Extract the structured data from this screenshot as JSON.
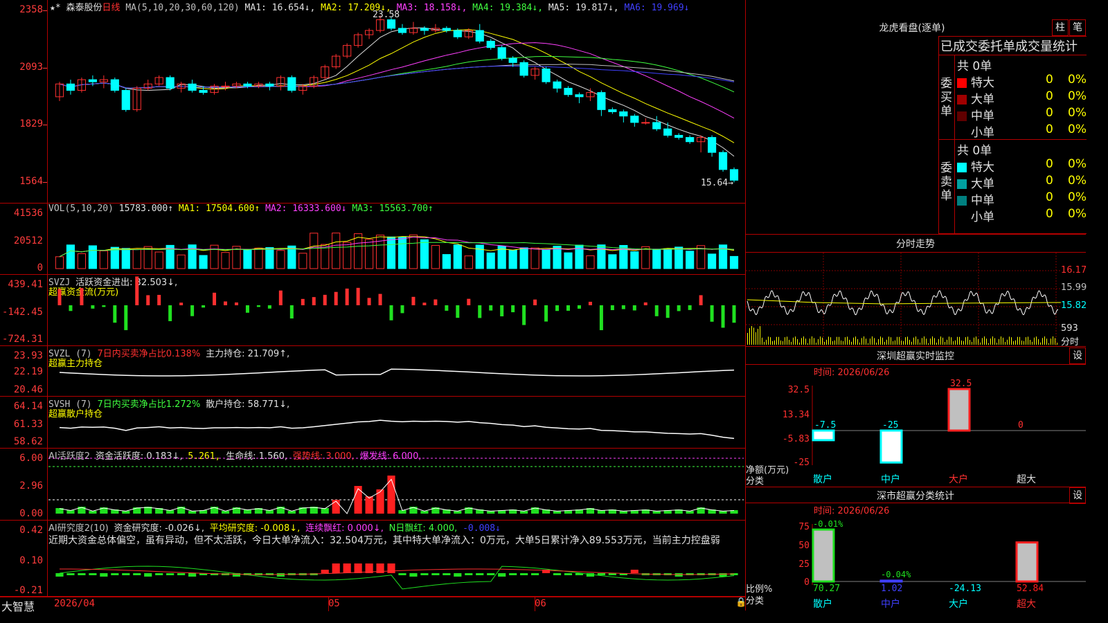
{
  "stock": {
    "name": "森泰股份",
    "period": "日线"
  },
  "ma_header": {
    "label": "MA(5,10,20,30,60,120)",
    "items": [
      {
        "text": "MA1: 16.654↓",
        "color": "#e0e0e0"
      },
      {
        "text": "MA2: 17.209↓",
        "color": "#ffff00"
      },
      {
        "text": "MA3: 18.158↓",
        "color": "#ff40ff"
      },
      {
        "text": "MA4: 19.384↓",
        "color": "#40ff40"
      },
      {
        "text": "MA5: 19.817↓",
        "color": "#e0e0e0"
      },
      {
        "text": "MA6: 19.969↓",
        "color": "#4040ff"
      }
    ]
  },
  "price_axis": [
    "2358",
    "2093",
    "1829",
    "1564"
  ],
  "price_high_label": "23.58",
  "price_low_label": "15.64",
  "vol_header": {
    "label": "VOL(5,10,20)",
    "value": "15783.000↑",
    "ma1": "MA1: 17504.600↑",
    "ma2": "MA2: 16333.600↓",
    "ma3": "MA3: 15563.700↑"
  },
  "vol_axis": [
    "41536",
    "20512",
    "0"
  ],
  "svzj": {
    "title": "SVZJ",
    "label": "活跃资金进出: 32.503↓,",
    "sub": "超赢资金流(万元)",
    "axis": [
      "439.41",
      "-142.45",
      "-724.31"
    ]
  },
  "svzl": {
    "title": "SVZL (7)",
    "ratio": "7日内买卖净占比0.138%",
    "hold": "主力持仓: 21.709↑,",
    "sub": "超赢主力持仓",
    "axis": [
      "23.93",
      "22.19",
      "20.46"
    ]
  },
  "svsh": {
    "title": "SVSH (7)",
    "ratio": "7日内买卖净占比1.272%",
    "hold": "散户持仓: 58.771↓,",
    "sub": "超赢散户持仓",
    "axis": [
      "64.14",
      "61.33",
      "58.62"
    ]
  },
  "ai_act": {
    "title": "AI活跃度2",
    "a": "资金活跃度: 0.183↓,",
    "b": "5.261,",
    "c": "生命线: 1.560,",
    "d": "强势线: 3.000,",
    "e": "爆发线: 6.000,",
    "axis": [
      "6.00",
      "2.96",
      "0.00"
    ]
  },
  "ai_res": {
    "title": "AI研究度2(10)",
    "a": "资金研究度: -0.026↓,",
    "b": "平均研究度: -0.008↓,",
    "c": "连续飘红: 0.000↓,",
    "d": "N日飘红: 4.000,",
    "e": "-0.008↓",
    "axis": [
      "0.42",
      "0.10",
      "-0.21"
    ],
    "comment": "近期大资金总体偏空，虽有异动，但不太活跃，今日大单净流入：32.504万元，其中特大单净流入：0万元，大单5日累计净入89.553万元，当前主力控盘弱"
  },
  "bottom": {
    "brand": "大智慧",
    "date": "2026/04",
    "m5": "05",
    "m6": "06"
  },
  "right": {
    "dragon_title": "龙虎看盘(逐单)",
    "tab_zhu": "柱",
    "tab_bi": "笔",
    "stats_title": "已成交委托单成交量统计",
    "buy": {
      "side": "委买单",
      "total": "共 0单",
      "rows": [
        {
          "name": "特大",
          "n": "0",
          "pct": "0%",
          "color": "#ff0000"
        },
        {
          "name": "大单",
          "n": "0",
          "pct": "0%",
          "color": "#a00000"
        },
        {
          "name": "中单",
          "n": "0",
          "pct": "0%",
          "color": "#600000"
        },
        {
          "name": "小单",
          "n": "0",
          "pct": "0%",
          "color": "#000000"
        }
      ]
    },
    "sell": {
      "side": "委卖单",
      "total": "共 0单",
      "rows": [
        {
          "name": "特大",
          "n": "0",
          "pct": "0%",
          "color": "#00ffff"
        },
        {
          "name": "大单",
          "n": "0",
          "pct": "0%",
          "color": "#00a0a0"
        },
        {
          "name": "中单",
          "n": "0",
          "pct": "0%",
          "color": "#008080"
        },
        {
          "name": "小单",
          "n": "0",
          "pct": "0%",
          "color": "#000000"
        }
      ]
    },
    "intraday_title": "分时走势",
    "intraday_axis": [
      "16.17",
      "15.99",
      "15.82"
    ],
    "intraday_vol": "593",
    "intraday_unit": "分时",
    "sz_monitor": {
      "title": "深圳超赢实时监控",
      "set": "设",
      "time": "时间: 2026/06/26",
      "axis": [
        "32.5",
        "13.34",
        "-5.83",
        "-25"
      ],
      "unit": "净额(万元)",
      "cat": "分类",
      "bars": [
        {
          "label": "散户",
          "value": -7.5,
          "vtext": "-7.5"
        },
        {
          "label": "中户",
          "value": -25,
          "vtext": "-25"
        },
        {
          "label": "大户",
          "value": 32.5,
          "vtext": "32.5"
        },
        {
          "label": "超大",
          "value": 0,
          "vtext": "0"
        }
      ]
    },
    "sz_class": {
      "title": "深市超赢分类统计",
      "set": "设",
      "time": "时间: 2026/06/26",
      "axis": [
        "75",
        "50",
        "25",
        "0"
      ],
      "unit": "比例%",
      "cat": "分类",
      "bars": [
        {
          "label": "散户",
          "value": 70.27,
          "vtext": "70.27",
          "top": "-0.01%"
        },
        {
          "label": "中户",
          "value": 1.02,
          "vtext": "1.02",
          "top": "-0.04%"
        },
        {
          "label": "大户",
          "value": -24.13,
          "vtext": "-24.13",
          "top": ""
        },
        {
          "label": "超大",
          "value": 52.84,
          "vtext": "52.84",
          "top": ""
        }
      ]
    }
  },
  "chart_data": {
    "type": "candlestick",
    "candles": [
      [
        19.8,
        20.4,
        20.5,
        19.6
      ],
      [
        20.4,
        20.1,
        20.6,
        19.9
      ],
      [
        20.1,
        20.6,
        20.7,
        20.0
      ],
      [
        20.6,
        20.5,
        20.8,
        20.3
      ],
      [
        20.5,
        20.6,
        20.8,
        20.2
      ],
      [
        20.6,
        20.1,
        20.7,
        20.0
      ],
      [
        20.1,
        19.2,
        20.2,
        19.1
      ],
      [
        19.2,
        20.2,
        20.3,
        19.1
      ],
      [
        20.2,
        20.4,
        20.6,
        20.1
      ],
      [
        20.4,
        20.7,
        20.8,
        20.3
      ],
      [
        20.7,
        20.2,
        20.8,
        20.1
      ],
      [
        20.2,
        20.4,
        20.5,
        20.0
      ],
      [
        20.4,
        20.1,
        20.6,
        20.0
      ],
      [
        20.1,
        20.0,
        20.3,
        19.9
      ],
      [
        20.0,
        20.3,
        20.4,
        19.9
      ],
      [
        20.3,
        20.3,
        20.5,
        20.1
      ],
      [
        20.3,
        20.4,
        20.5,
        20.2
      ],
      [
        20.4,
        20.3,
        20.5,
        20.2
      ],
      [
        20.3,
        20.4,
        20.5,
        20.2
      ],
      [
        20.4,
        20.3,
        20.5,
        20.1
      ],
      [
        20.3,
        20.7,
        20.8,
        20.1
      ],
      [
        20.7,
        20.1,
        20.8,
        20.0
      ],
      [
        20.1,
        20.3,
        20.4,
        19.9
      ],
      [
        20.3,
        20.7,
        20.8,
        20.2
      ],
      [
        20.7,
        21.2,
        21.3,
        20.6
      ],
      [
        21.2,
        21.7,
        21.8,
        21.1
      ],
      [
        21.7,
        22.2,
        22.3,
        21.6
      ],
      [
        22.2,
        22.7,
        22.8,
        22.1
      ],
      [
        22.7,
        22.9,
        23.0,
        22.5
      ],
      [
        22.9,
        23.4,
        23.6,
        22.8
      ],
      [
        23.4,
        23.0,
        23.5,
        22.9
      ],
      [
        23.0,
        22.8,
        23.2,
        22.7
      ],
      [
        22.8,
        23.0,
        23.3,
        22.7
      ],
      [
        23.0,
        22.9,
        23.1,
        22.7
      ],
      [
        22.9,
        23.0,
        23.2,
        22.8
      ],
      [
        23.0,
        22.9,
        23.1,
        22.8
      ],
      [
        22.9,
        22.6,
        23.0,
        22.5
      ],
      [
        22.6,
        22.9,
        23.0,
        22.5
      ],
      [
        22.9,
        22.4,
        23.2,
        22.3
      ],
      [
        22.4,
        22.1,
        22.5,
        22.0
      ],
      [
        22.1,
        21.6,
        22.2,
        21.5
      ],
      [
        21.6,
        21.4,
        21.7,
        21.2
      ],
      [
        21.4,
        20.8,
        21.5,
        20.7
      ],
      [
        20.8,
        21.1,
        21.2,
        20.6
      ],
      [
        21.1,
        20.5,
        21.2,
        20.4
      ],
      [
        20.5,
        20.2,
        20.6,
        20.0
      ],
      [
        20.2,
        19.9,
        20.3,
        19.8
      ],
      [
        19.9,
        19.8,
        20.0,
        19.5
      ],
      [
        19.8,
        20.0,
        20.2,
        19.6
      ],
      [
        20.0,
        19.2,
        20.1,
        18.9
      ],
      [
        19.2,
        19.1,
        19.3,
        19.0
      ],
      [
        19.1,
        18.9,
        19.2,
        18.6
      ],
      [
        18.9,
        18.6,
        19.0,
        18.4
      ],
      [
        18.6,
        18.6,
        18.8,
        18.5
      ],
      [
        18.6,
        18.3,
        18.9,
        18.2
      ],
      [
        18.3,
        18.0,
        18.6,
        17.9
      ],
      [
        18.0,
        17.9,
        18.1,
        17.8
      ],
      [
        17.9,
        17.7,
        18.0,
        17.6
      ],
      [
        17.7,
        17.9,
        18.0,
        17.2
      ],
      [
        17.9,
        17.2,
        18.0,
        17.0
      ],
      [
        17.2,
        16.4,
        17.3,
        16.3
      ],
      [
        16.4,
        15.9,
        16.5,
        15.8
      ]
    ],
    "ylim": [
      15.64,
      23.58
    ]
  }
}
